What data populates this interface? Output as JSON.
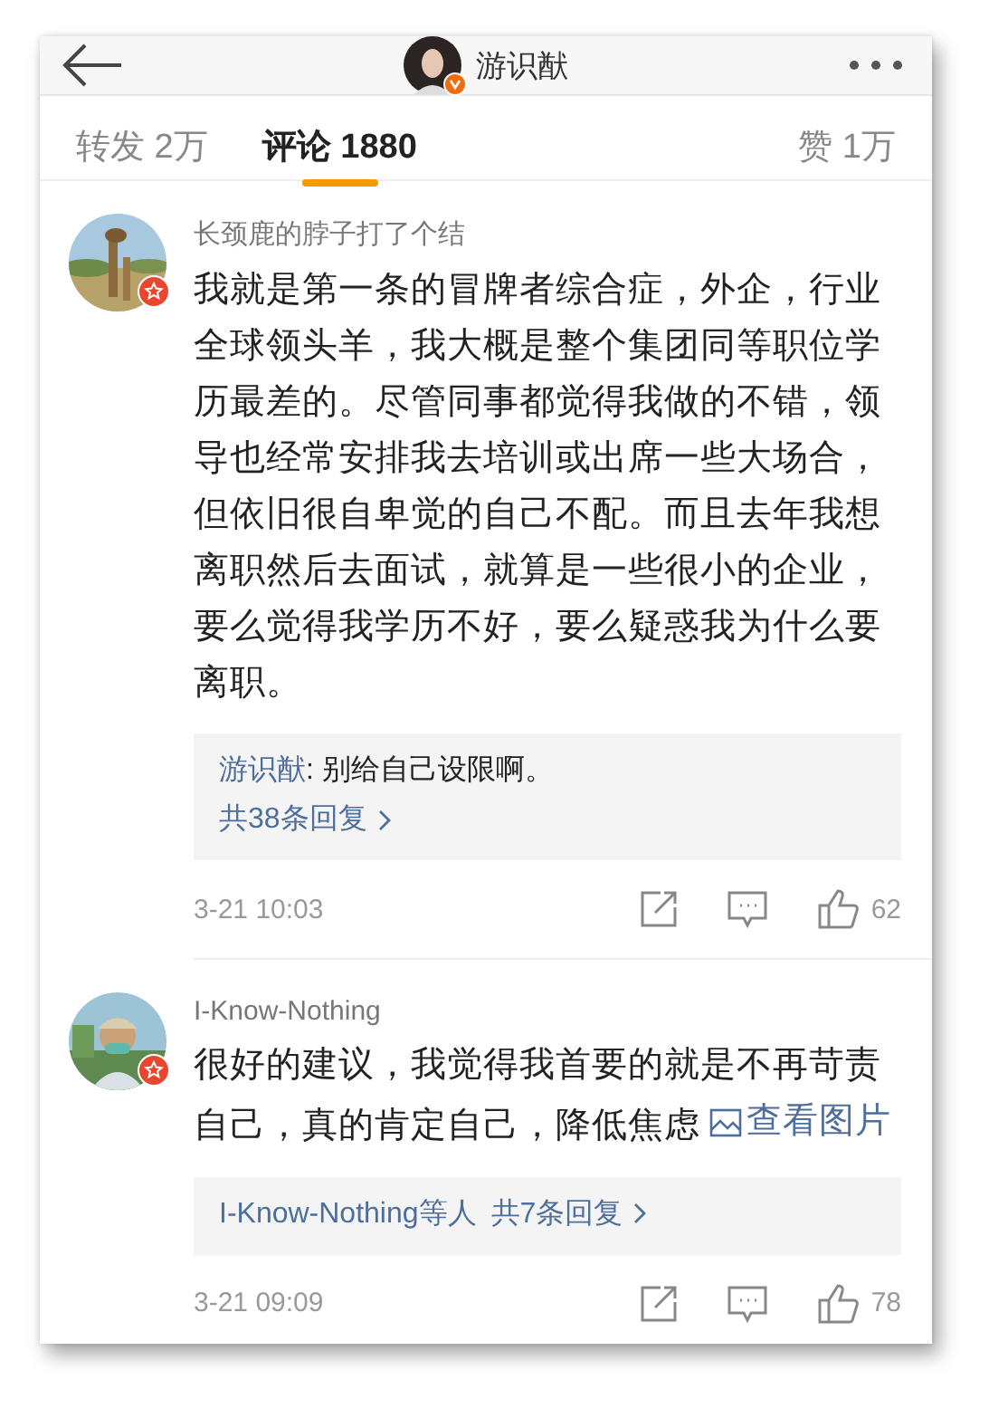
{
  "header": {
    "title": "游识猷"
  },
  "tabs": [
    {
      "label": "转发 2万",
      "selected": false
    },
    {
      "label": "评论 1880",
      "selected": true
    },
    {
      "label": "赞 1万",
      "selected": false
    }
  ],
  "comments": [
    {
      "author": "长颈鹿的脖子打了个结",
      "text": "我就是第一条的冒牌者综合症，外企，行业全球领头羊，我大概是整个集团同等职位学历最差的。尽管同事都觉得我做的不错，领导也经常安排我去培训或出席一些大场合，但依旧很自卑觉的自己不配。而且去年我想离职然后去面试，就算是一些很小的企业，要么觉得我学历不好，要么疑惑我为什么要离职。",
      "replies": {
        "preview_author": "游识猷",
        "preview_text": ": 别给自己设限啊。",
        "link": "共38条回复"
      },
      "time": "3-21 10:03",
      "likes": "62"
    },
    {
      "author": "I-Know-Nothing",
      "text": "很好的建议，我觉得我首要的就是不再苛责自己，真的肯定自己，降低焦虑 ",
      "image_link": "查看图片",
      "replies": {
        "participants": "I-Know-Nothing等人",
        "link": "共7条回复"
      },
      "time": "3-21 09:09",
      "likes": "78"
    }
  ]
}
